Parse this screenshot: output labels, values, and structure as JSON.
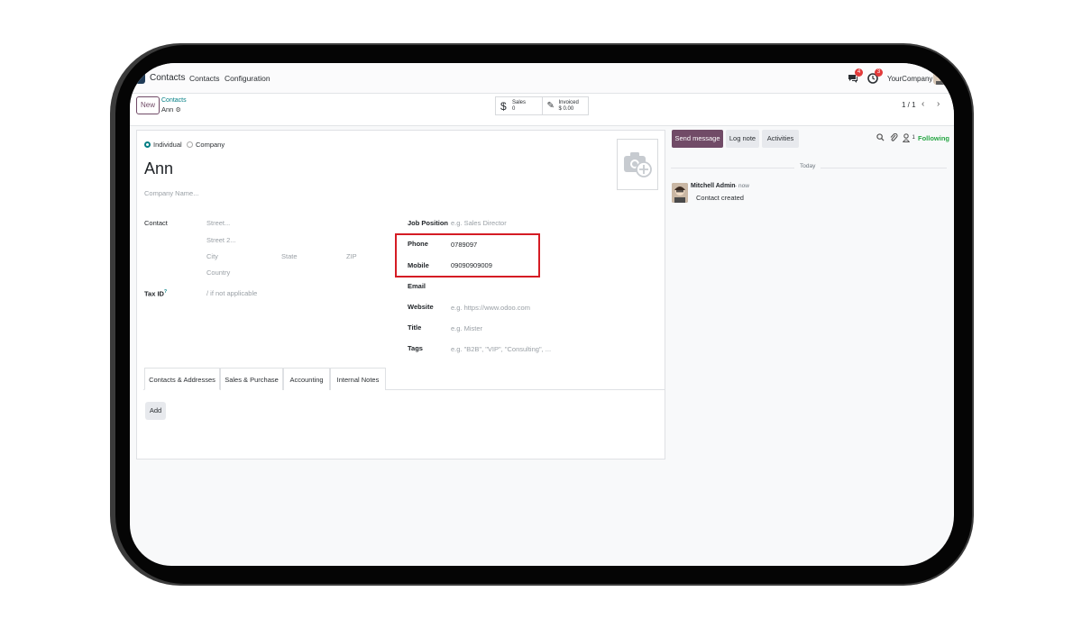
{
  "navbar": {
    "app_name": "Contacts",
    "menu": [
      "Contacts",
      "Configuration"
    ],
    "messages_badge": "4",
    "activities_badge": "3",
    "company": "YourCompany"
  },
  "control_panel": {
    "new_label": "New",
    "breadcrumb_parent": "Contacts",
    "breadcrumb_current": "Ann",
    "smart_buttons": [
      {
        "label": "Sales",
        "value": "0",
        "icon": "dollar-icon"
      },
      {
        "label": "Invoiced",
        "value": "$ 0.00",
        "icon": "edit-icon"
      }
    ],
    "pager": "1 / 1"
  },
  "form": {
    "type_options": [
      "Individual",
      "Company"
    ],
    "type_selected": "Individual",
    "name": "Ann",
    "company_name_placeholder": "Company Name...",
    "address_label": "Contact",
    "street_placeholder": "Street...",
    "street2_placeholder": "Street 2...",
    "city_placeholder": "City",
    "state_placeholder": "State",
    "zip_placeholder": "ZIP",
    "country_placeholder": "Country",
    "tax_id_label": "Tax ID",
    "tax_id_help": "?",
    "tax_id_placeholder": "/ if not applicable",
    "job_position_label": "Job Position",
    "job_position_placeholder": "e.g. Sales Director",
    "phone_label": "Phone",
    "phone_value": "0789097",
    "mobile_label": "Mobile",
    "mobile_value": "09090909009",
    "email_label": "Email",
    "website_label": "Website",
    "website_placeholder": "e.g. https://www.odoo.com",
    "title_label": "Title",
    "title_placeholder": "e.g. Mister",
    "tags_label": "Tags",
    "tags_placeholder": "e.g. \"B2B\", \"VIP\", \"Consulting\", ...",
    "tabs": [
      "Contacts & Addresses",
      "Sales & Purchase",
      "Accounting",
      "Internal Notes"
    ],
    "active_tab": "Contacts & Addresses",
    "add_label": "Add"
  },
  "chatter": {
    "send_message": "Send message",
    "log_note": "Log note",
    "activities": "Activities",
    "followers_count": "1",
    "following": "Following",
    "today": "Today",
    "author": "Mitchell Admin",
    "time": "- now",
    "body": "Contact created"
  },
  "colors": {
    "brand": "#714b67",
    "link": "#017e84",
    "highlight": "#d51c24",
    "following": "#28a745"
  }
}
